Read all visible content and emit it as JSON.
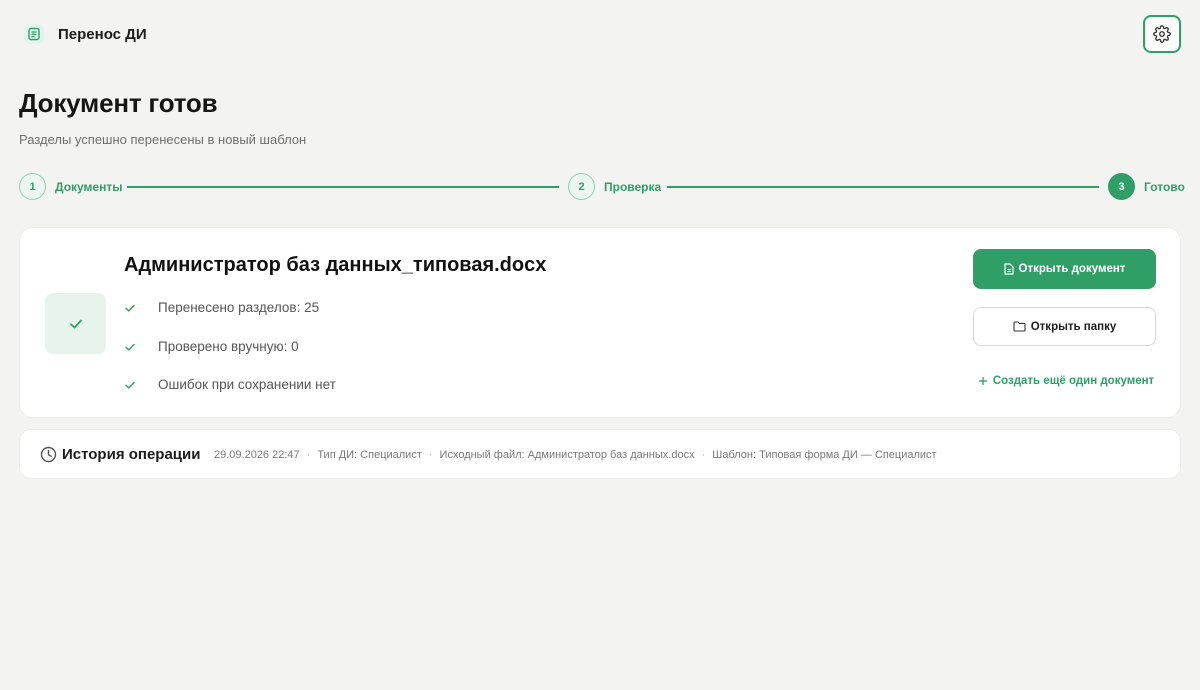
{
  "colors": {
    "accent": "#2f9e67",
    "background": "#f3f3f1",
    "card": "#ffffff"
  },
  "header": {
    "app_title": "Перенос ДИ",
    "app_icon": "document-icon",
    "settings_icon": "gear-icon"
  },
  "page": {
    "title": "Документ готов",
    "subtitle": "Разделы успешно перенесены в новый шаблон"
  },
  "stepper": {
    "steps": [
      {
        "number": "1",
        "label": "Документы",
        "state": "done"
      },
      {
        "number": "2",
        "label": "Проверка",
        "state": "done"
      },
      {
        "number": "3",
        "label": "Готово",
        "state": "active"
      }
    ]
  },
  "result": {
    "file_name": "Администратор баз данных_типовая.docx",
    "stats": [
      "Перенесено разделов: 25",
      "Проверено вручную: 0",
      "Ошибок при сохранении нет"
    ],
    "open_document_label": "Открыть документ",
    "open_folder_label": "Открыть папку",
    "create_another_label": "Создать ещё один документ"
  },
  "history": {
    "title": "История операции",
    "date": "29.09.2026 22:47",
    "di_type": "Тип ДИ: Специалист",
    "source_file": "Исходный файл: Администратор баз данных.docx",
    "template": "Шаблон: Типовая форма ДИ — Специалист",
    "separator": "·"
  }
}
